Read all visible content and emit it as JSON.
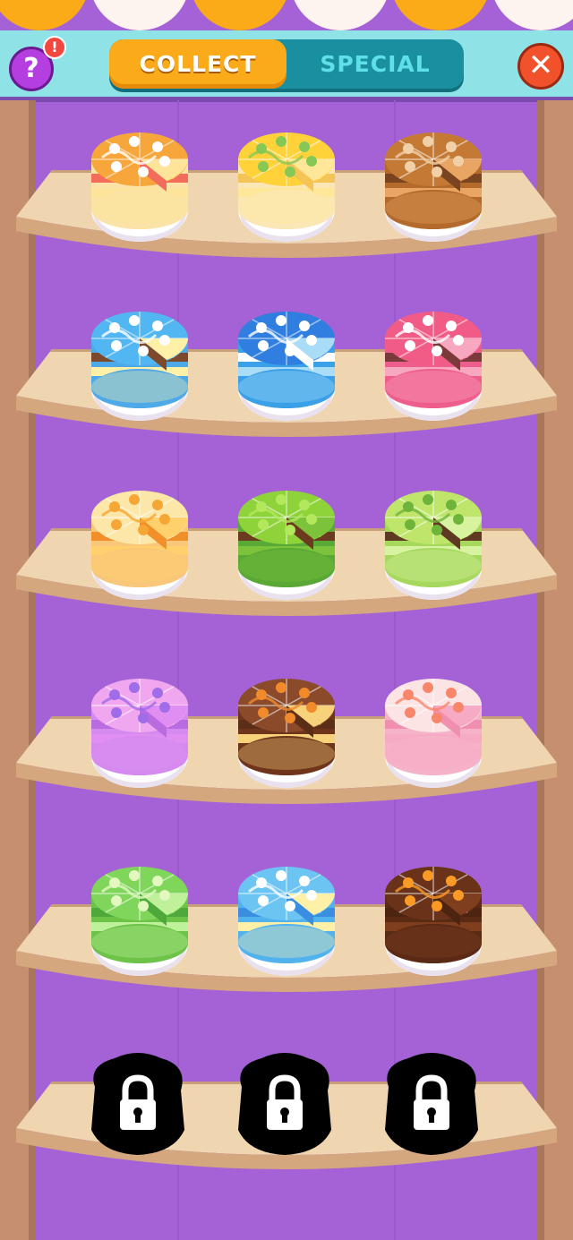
{
  "header": {
    "help_glyph": "?",
    "alert_glyph": "!",
    "tabs": [
      {
        "label": "COLLECT",
        "active": true
      },
      {
        "label": "SPECIAL",
        "active": false
      }
    ],
    "close_glyph": "✕"
  },
  "colors": {
    "background": "#a462d6",
    "tab_active": "#fbab1a",
    "tab_inactive": "#1a8fa0",
    "shelf": "#efd5b0",
    "help_button": "#b43ee0",
    "close_button": "#f1522b"
  },
  "shelves": [
    {
      "cakes": [
        {
          "name": "orange-cream-cake",
          "top": "#f6a63a",
          "sponge": "#fde49a",
          "filling": "#f36b5b",
          "base": "#fbe2a6",
          "icing": "#ffffff"
        },
        {
          "name": "lemon-charlotte-cake",
          "top": "#ffd23a",
          "sponge": "#ffe79a",
          "filling": "#f4c456",
          "base": "#fbe7b6",
          "icing": "#86c855"
        },
        {
          "name": "caramel-chocolate-cake",
          "top": "#c47a35",
          "sponge": "#e9a563",
          "filling": "#7b4420",
          "base": "#b36a2b",
          "icing": "#f1d0a8"
        }
      ]
    },
    {
      "cakes": [
        {
          "name": "blue-swirl-cake",
          "top": "#52b6f2",
          "sponge": "#fff0a8",
          "filling": "#7c4a2a",
          "base": "#4ea9e8",
          "icing": "#ffffff"
        },
        {
          "name": "blueberry-cake",
          "top": "#2f7ee0",
          "sponge": "#a9dcf6",
          "filling": "#ffffff",
          "base": "#3aa1e8",
          "icing": "#ffffff"
        },
        {
          "name": "cherry-pink-cake",
          "top": "#f05c86",
          "sponge": "#f7a7bf",
          "filling": "#7b3a3a",
          "base": "#ee5e8c",
          "icing": "#ffffff"
        }
      ]
    },
    {
      "cakes": [
        {
          "name": "apricot-layer-cake",
          "top": "#fde7a8",
          "sponge": "#ffd06b",
          "filling": "#f18f2a",
          "base": "#f8c77a",
          "icing": "#f6a634"
        },
        {
          "name": "matcha-cake",
          "top": "#8fd33a",
          "sponge": "#7cc23a",
          "filling": "#6b3a1f",
          "base": "#5aa836",
          "icing": "#b4e85c"
        },
        {
          "name": "kiwi-mousse-cake",
          "top": "#bfe66b",
          "sponge": "#d8f3a0",
          "filling": "#5e3a23",
          "base": "#a7d85e",
          "icing": "#6fb43a"
        }
      ]
    },
    {
      "cakes": [
        {
          "name": "purple-berry-cake",
          "top": "#f0a7ef",
          "sponge": "#e08ef1",
          "filling": "#b86ce0",
          "base": "#d58af0",
          "icing": "#a06ce8"
        },
        {
          "name": "pretzel-chocolate-cake",
          "top": "#8b4a2a",
          "sponge": "#f7d27a",
          "filling": "#5b2e17",
          "base": "#6e351b",
          "icing": "#f08a2a"
        },
        {
          "name": "peach-strawberry-cake",
          "top": "#fce4e4",
          "sponge": "#f7aac3",
          "filling": "#f08fb0",
          "base": "#f6b2c8",
          "icing": "#f7866b"
        }
      ]
    },
    {
      "cakes": [
        {
          "name": "green-apple-cake",
          "top": "#7fd65b",
          "sponge": "#bff09a",
          "filling": "#4ea83a",
          "base": "#6cc348",
          "icing": "#e2f8bf"
        },
        {
          "name": "blue-cream-cake",
          "top": "#6cc4f2",
          "sponge": "#fff0a8",
          "filling": "#3a8ee0",
          "base": "#52b2ee",
          "icing": "#ffffff"
        },
        {
          "name": "heart-brownie-cake",
          "top": "#6a3319",
          "sponge": "#7f3f1f",
          "filling": "#4d240f",
          "base": "#5a2a14",
          "icing": "#fb9a24"
        }
      ]
    },
    {
      "locked": 3
    }
  ]
}
